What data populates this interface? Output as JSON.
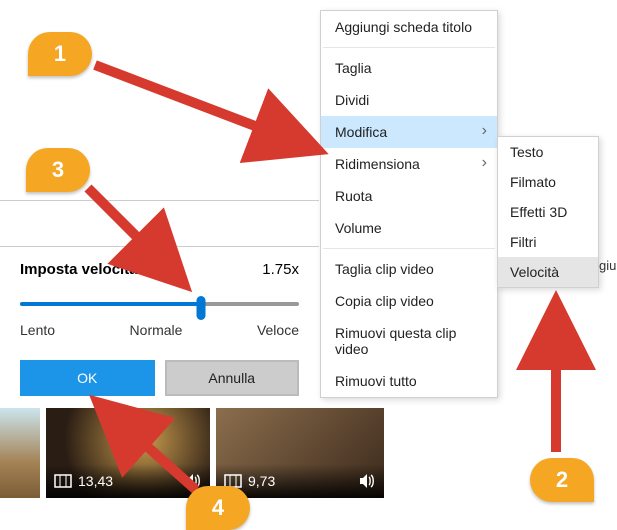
{
  "context_menu": {
    "items": [
      {
        "label": "Aggiungi scheda titolo"
      },
      {
        "label": "Taglia"
      },
      {
        "label": "Dividi"
      },
      {
        "label": "Modifica",
        "submenu": true,
        "highlight": true
      },
      {
        "label": "Ridimensiona",
        "submenu": true
      },
      {
        "label": "Ruota"
      },
      {
        "label": "Volume"
      },
      {
        "label": "Taglia clip video"
      },
      {
        "label": "Copia clip video"
      },
      {
        "label": "Rimuovi questa clip video"
      },
      {
        "label": "Rimuovi tutto"
      }
    ]
  },
  "sub_menu": {
    "items": [
      {
        "label": "Testo"
      },
      {
        "label": "Filmato"
      },
      {
        "label": "Effetti 3D"
      },
      {
        "label": "Filtri"
      },
      {
        "label": "Velocità",
        "highlight": true
      }
    ]
  },
  "speed_panel": {
    "title": "Imposta velocità clip",
    "value": "1.75x",
    "labels": {
      "slow": "Lento",
      "normal": "Normale",
      "fast": "Veloce"
    },
    "slider_percent": 65,
    "ok": "OK",
    "cancel": "Annulla"
  },
  "thumbnails": [
    {
      "duration": "",
      "icons": []
    },
    {
      "duration": "13,43",
      "icons": [
        "aspect",
        "sound"
      ]
    },
    {
      "duration": "9,73",
      "icons": [
        "aspect",
        "sound"
      ]
    }
  ],
  "callouts": {
    "1": "1",
    "2": "2",
    "3": "3",
    "4": "4"
  },
  "truncated": "giu",
  "colors": {
    "accent": "#0078d4",
    "callout": "#f5a623",
    "arrow": "#d63a2e"
  }
}
